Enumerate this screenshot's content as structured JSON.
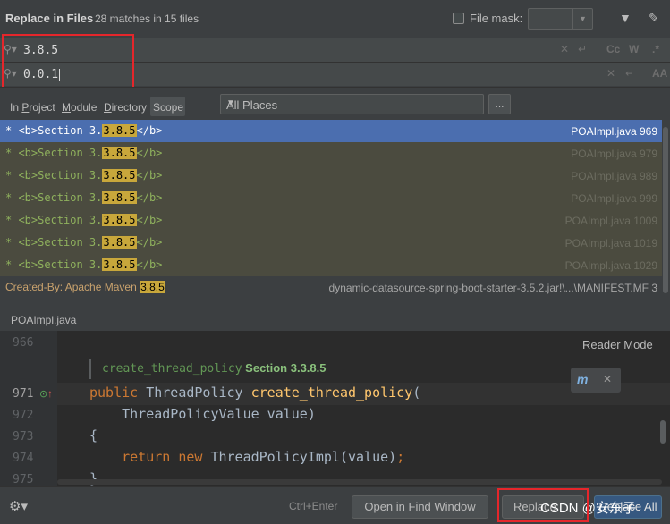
{
  "header": {
    "title": "Replace in Files",
    "matches": "28 matches in 15 files",
    "file_mask_label": "File mask:",
    "file_mask_value": ""
  },
  "search": {
    "find_value": "3.8.5",
    "replace_value": "0.0.1",
    "find_options": [
      "Cc",
      "W",
      ".*"
    ],
    "replace_options": [
      "AA"
    ]
  },
  "scope": {
    "tabs": [
      {
        "label": "In Project"
      },
      {
        "label": "Module"
      },
      {
        "label": "Directory"
      },
      {
        "label": "Scope"
      }
    ],
    "places": "All Places",
    "more": "..."
  },
  "results": [
    {
      "pre": "* <b>Section 3.",
      "match": "3.8.5",
      "post": "</b>",
      "file": "POAImpl.java 969"
    },
    {
      "pre": "* <b>Section 3.",
      "match": "3.8.5",
      "post": "</b>",
      "file": "POAImpl.java 979"
    },
    {
      "pre": "* <b>Section 3.",
      "match": "3.8.5",
      "post": "</b>",
      "file": "POAImpl.java 989"
    },
    {
      "pre": "* <b>Section 3.",
      "match": "3.8.5",
      "post": "</b>",
      "file": "POAImpl.java 999"
    },
    {
      "pre": "* <b>Section 3.",
      "match": "3.8.5",
      "post": "</b>",
      "file": "POAImpl.java 1009"
    },
    {
      "pre": "* <b>Section 3.",
      "match": "3.8.5",
      "post": "</b>",
      "file": "POAImpl.java 1019"
    },
    {
      "pre": "* <b>Section 3.",
      "match": "3.8.5",
      "post": "</b>",
      "file": "POAImpl.java 1029"
    },
    {
      "pre": "Created-By: Apache Maven ",
      "match": "3.8.5",
      "post": "",
      "file": "dynamic-datasource-spring-boot-starter-3.5.2.jar!\\...\\MANIFEST.MF 3"
    }
  ],
  "preview": {
    "filename": "POAImpl.java",
    "reader_mode": "Reader Mode",
    "doc_method": "create_thread_policy",
    "doc_section": "Section 3.3.8.5",
    "lines": [
      {
        "num": "966"
      },
      {
        "num": "971"
      },
      {
        "num": "972"
      },
      {
        "num": "973"
      },
      {
        "num": "974"
      },
      {
        "num": "975"
      }
    ],
    "code": {
      "l971_kw": "public",
      "l971_type": " ThreadPolicy ",
      "l971_fn": "create_thread_policy",
      "l971_end": "(",
      "l972": "    ThreadPolicyValue value)",
      "l973": "{",
      "l974_kw1": "    return",
      "l974_kw2": " new",
      "l974_rest": " ThreadPolicyImpl(value)",
      "l974_semi": ";",
      "l975": "}"
    }
  },
  "footer": {
    "hint": "Ctrl+Enter",
    "open_in_find": "Open in Find Window",
    "replace": "Replace",
    "replace_all": "Replace All",
    "watermark": "CSDN @安东子"
  }
}
